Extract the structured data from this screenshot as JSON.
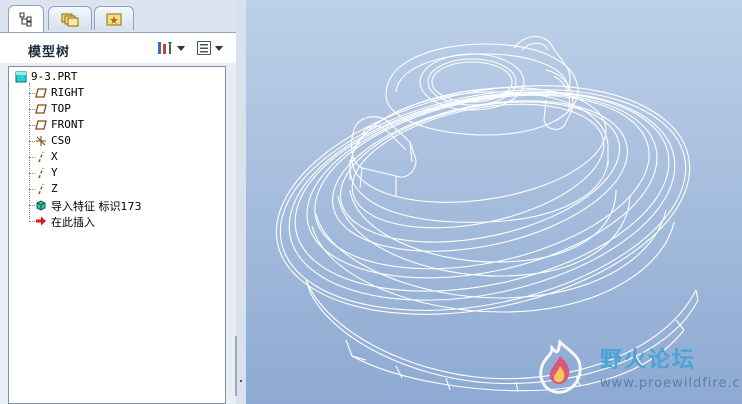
{
  "model_tree": {
    "title": "模型树",
    "tabs": [
      "model-tree-tab",
      "folder-browser-tab",
      "favorites-tab"
    ],
    "items": [
      {
        "label": "9-3.PRT",
        "icon": "part-icon"
      },
      {
        "label": "RIGHT",
        "icon": "datum-plane-icon"
      },
      {
        "label": "TOP",
        "icon": "datum-plane-icon"
      },
      {
        "label": "FRONT",
        "icon": "datum-plane-icon"
      },
      {
        "label": "CS0",
        "icon": "coordinate-system-icon"
      },
      {
        "label": "X",
        "icon": "datum-axis-icon"
      },
      {
        "label": "Y",
        "icon": "datum-axis-icon"
      },
      {
        "label": "Z",
        "icon": "datum-axis-icon"
      },
      {
        "label": "导入特征 标识173",
        "icon": "import-feature-icon"
      },
      {
        "label": "在此插入",
        "icon": "insert-here-arrow-icon"
      }
    ]
  },
  "watermark": {
    "title": "野火论坛",
    "url": "www.proewildfire.cn"
  },
  "colors": {
    "viewport_top": "#bcd0e8",
    "viewport_bottom": "#8eaad2",
    "wireframe": "#ffffff"
  }
}
